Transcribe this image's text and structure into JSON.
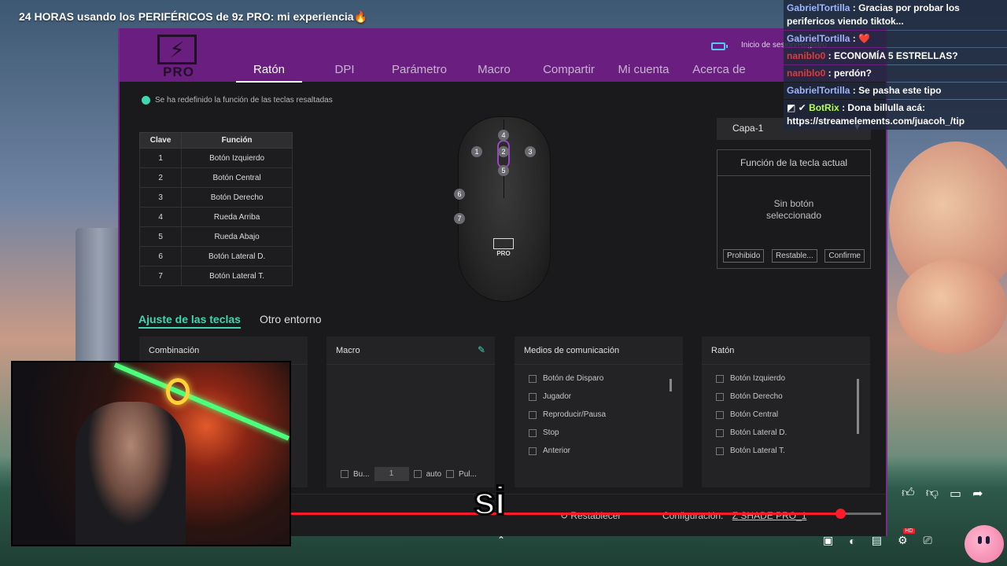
{
  "video": {
    "title": "24 HORAS usando los PERIFÉRICOS de 9z PRO: mi experiencia🔥",
    "caption": "si",
    "progress_percent": 93
  },
  "app": {
    "logo_text": "PRO",
    "login": "Inicio de sesión/Registro",
    "tabs": [
      {
        "label": "Ratón",
        "active": true
      },
      {
        "label": "DPI"
      },
      {
        "label": "Parámetro"
      },
      {
        "label": "Macro"
      },
      {
        "label": "Compartir"
      },
      {
        "label": "Mi cuenta"
      },
      {
        "label": "Acerca de"
      }
    ],
    "notice": "Se ha redefinido la función de las teclas resaltadas",
    "key_table": {
      "headers": [
        "Clave",
        "Función"
      ],
      "rows": [
        [
          "1",
          "Botón Izquierdo"
        ],
        [
          "2",
          "Botón Central"
        ],
        [
          "3",
          "Botón Derecho"
        ],
        [
          "4",
          "Rueda Arriba"
        ],
        [
          "5",
          "Rueda Abajo"
        ],
        [
          "6",
          "Botón Lateral D."
        ],
        [
          "7",
          "Botón Lateral T."
        ]
      ]
    },
    "mouse_badges": [
      "1",
      "2",
      "3",
      "4",
      "5",
      "6",
      "7"
    ],
    "mouse_logo": "PRO",
    "layer_select": "Capa-1",
    "function_box": {
      "title": "Función de la tecla actual",
      "empty_line1": "Sin botón",
      "empty_line2": "seleccionado",
      "buttons": [
        "Prohibido",
        "Restable...",
        "Confirme"
      ]
    },
    "subtabs": [
      {
        "label": "Ajuste de las teclas",
        "active": true
      },
      {
        "label": "Otro entorno"
      }
    ],
    "panels": {
      "combinacion": {
        "title": "Combinación"
      },
      "macro": {
        "title": "Macro",
        "loop_label": "Bu...",
        "count_value": "1",
        "auto_label": "auto",
        "press_label": "Pul..."
      },
      "medios": {
        "title": "Medios de comunicación",
        "options": [
          "Botón de Disparo",
          "Jugador",
          "Reproducir/Pausa",
          "Stop",
          "Anterior"
        ]
      },
      "raton": {
        "title": "Ratón",
        "options": [
          "Botón Izquierdo",
          "Botón Derecho",
          "Botón Central",
          "Botón Lateral D.",
          "Botón Lateral T."
        ]
      }
    },
    "bottom": {
      "reset": "Restablecer",
      "config_label": "Configuración:",
      "config_value": "Z SHADE PRO_1"
    }
  },
  "chat": [
    {
      "user": "GabrielTortilla",
      "text": "Gracias por probar los perifericos viendo tiktok...",
      "color": "blue"
    },
    {
      "user": "GabrielTortilla",
      "text": "❤️",
      "color": "blue"
    },
    {
      "user": "naniblo0",
      "text": "ECONOMÍA 5 ESTRELLAS?",
      "color": "red"
    },
    {
      "user": "naniblo0",
      "text": "perdón?",
      "color": "red"
    },
    {
      "user": "GabrielTortilla",
      "text": "Se pasha este tipo",
      "color": "blue"
    },
    {
      "user": "BotRix",
      "text": "Dona billulla acá: https://streamelements.com/juacoh_/tip",
      "color": "green"
    }
  ]
}
